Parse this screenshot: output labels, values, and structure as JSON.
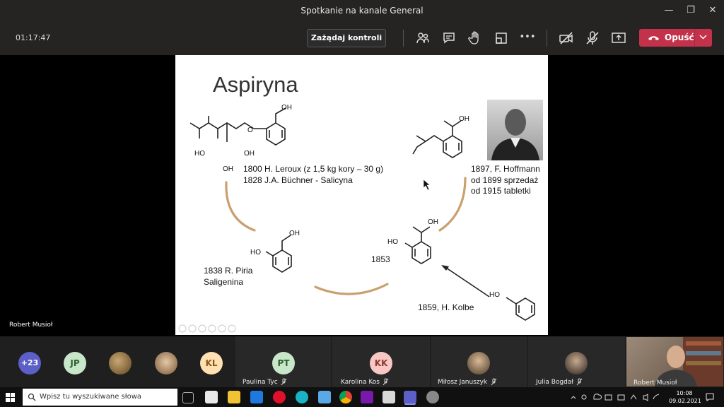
{
  "window": {
    "title": "Spotkanie na kanale General",
    "minimize": "—",
    "maximize": "❐",
    "close": "✕"
  },
  "toolbar": {
    "timer": "01:17:47",
    "request_control": "Zażądaj kontroli",
    "more": "•••",
    "leave": "Opuść"
  },
  "slide": {
    "title": "Aspiryna",
    "salicin_text": [
      "1800 H. Leroux (z 1,5 kg kory – 30 g)",
      "1828 J.A. Büchner - Salicyna"
    ],
    "hoffmann_text": [
      "1897, F. Hoffmann",
      "od 1899 sprzedaż",
      "od 1915 tabletki"
    ],
    "saligenin_text": [
      "1838 R. Piria",
      "Saligenina"
    ],
    "year_1853": "1853",
    "kolbe_text": "1859, H. Kolbe",
    "chem_labels": {
      "oh": "OH",
      "ho": "HO",
      "o": "O"
    }
  },
  "presenter": {
    "name": "Robert Musioł"
  },
  "participants": {
    "overflow": "+23",
    "avatars": [
      {
        "initials": "JP",
        "color": "#c8e6c9",
        "text_color": "#2e5f30"
      },
      {
        "initials": "KL",
        "color": "#ffe0b2",
        "text_color": "#8a5a14"
      }
    ],
    "tiles": [
      {
        "initials": "PT",
        "name": "Paulina Tyc",
        "color": "#c8e6c9",
        "text_color": "#2e5f30"
      },
      {
        "initials": "KK",
        "name": "Karolina Kos",
        "color": "#f8c9c4",
        "text_color": "#8a3a33"
      },
      {
        "name": "Miłosz Januszyk"
      },
      {
        "name": "Julia Bogdał"
      }
    ],
    "self_name": "Robert Musioł"
  },
  "taskbar": {
    "search_placeholder": "Wpisz tu wyszukiwane słowa",
    "time": "10:08",
    "date": "09.02.2021"
  },
  "colors": {
    "leave": "#c4314b",
    "bar": "#252423",
    "arrow": "#c9a06e"
  }
}
